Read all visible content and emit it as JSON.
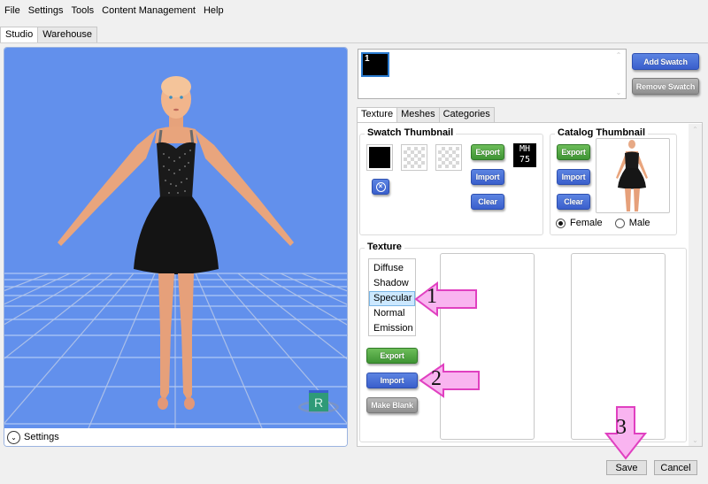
{
  "menu": [
    "File",
    "Settings",
    "Tools",
    "Content Management",
    "Help"
  ],
  "main_tabs": [
    {
      "label": "Studio",
      "active": true
    },
    {
      "label": "Warehouse",
      "active": false
    }
  ],
  "viewport": {
    "settings_label": "Settings",
    "gizmo_label": "R",
    "background_color": "#6290ec"
  },
  "swatches": {
    "items": [
      {
        "label": "1",
        "color": "#000000"
      }
    ],
    "add_label": "Add Swatch",
    "remove_label": "Remove Swatch"
  },
  "sub_tabs": [
    {
      "label": "Texture",
      "active": true
    },
    {
      "label": "Meshes",
      "active": false
    },
    {
      "label": "Categories",
      "active": false
    }
  ],
  "swatch_thumbnail": {
    "title": "Swatch Thumbnail",
    "export_label": "Export",
    "import_label": "Import",
    "clear_label": "Clear",
    "badge_line1": "MH",
    "badge_line2": "75"
  },
  "catalog_thumbnail": {
    "title": "Catalog Thumbnail",
    "export_label": "Export",
    "import_label": "Import",
    "clear_label": "Clear",
    "gender_options": [
      {
        "label": "Female",
        "selected": true
      },
      {
        "label": "Male",
        "selected": false
      }
    ]
  },
  "texture": {
    "title": "Texture",
    "types": [
      "Diffuse",
      "Shadow",
      "Specular",
      "Normal",
      "Emission"
    ],
    "selected": "Specular",
    "export_label": "Export",
    "import_label": "Import",
    "make_blank_label": "Make Blank"
  },
  "footer": {
    "save_label": "Save",
    "cancel_label": "Cancel"
  },
  "annotations": [
    {
      "number": "1",
      "target": "Specular",
      "direction": "left"
    },
    {
      "number": "2",
      "target": "Import",
      "direction": "left"
    },
    {
      "number": "3",
      "target": "Save",
      "direction": "down"
    }
  ],
  "colors": {
    "annotation_fill": "#f9b4f0",
    "annotation_stroke": "#e040c0",
    "button_blue": "#3a5fcc",
    "button_green": "#3f9434",
    "button_gray": "#8f8f8f"
  }
}
